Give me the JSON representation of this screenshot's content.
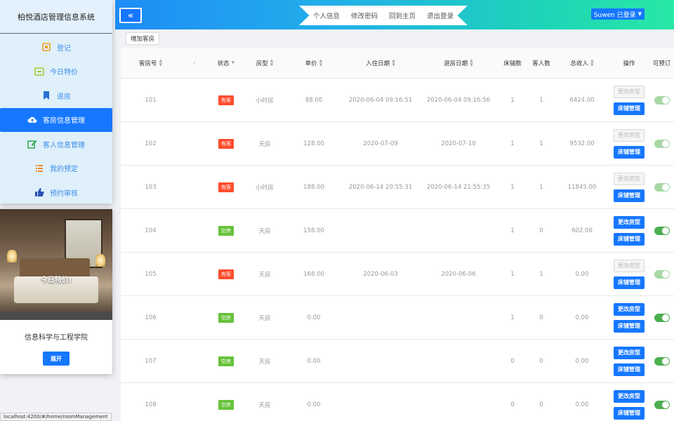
{
  "sidebar": {
    "title": "柏悦酒店管理信息系统",
    "items": [
      {
        "label": "登记",
        "icon": "register-icon",
        "active": false
      },
      {
        "label": "今日特价",
        "icon": "special-offer-icon",
        "active": false
      },
      {
        "label": "退房",
        "icon": "checkout-icon",
        "active": false
      },
      {
        "label": "客房信息管理",
        "icon": "cloud-upload-icon",
        "active": true
      },
      {
        "label": "客人信息管理",
        "icon": "edit-icon",
        "active": false
      },
      {
        "label": "我的预定",
        "icon": "list-icon",
        "active": false
      },
      {
        "label": "预约审核",
        "icon": "thumbs-up-icon",
        "active": false
      }
    ]
  },
  "promo": {
    "caption": "今日特价!",
    "text": "信息科学与工程学院",
    "button": "展开"
  },
  "topbar": {
    "collapse": "«",
    "nav": [
      "个人信息",
      "修改密码",
      "回到主页",
      "退出登录"
    ],
    "user": "Suwen 已登录"
  },
  "toolbar": {
    "add_label": "增加客房"
  },
  "table": {
    "headers": [
      "客房号",
      "状态",
      "房型",
      "单价",
      "入住日期",
      "退房日期",
      "床铺数",
      "客人数",
      "总收入",
      "操作",
      "可预订"
    ],
    "op_labels": {
      "modify": "更改房型",
      "bed": "床铺管理"
    },
    "rows": [
      {
        "room": "101",
        "status": "有客",
        "type": "小时房",
        "price": "88.00",
        "checkin": "2020-06-04 09:16:51",
        "checkout": "2020-06-04 09:16:56",
        "beds": "1",
        "guests": "1",
        "income": "6424.00",
        "modify_enabled": false,
        "bookable_dim": true
      },
      {
        "room": "102",
        "status": "有客",
        "type": "天房",
        "price": "128.00",
        "checkin": "2020-07-09",
        "checkout": "2020-07-10",
        "beds": "1",
        "guests": "1",
        "income": "9532.00",
        "modify_enabled": false,
        "bookable_dim": true
      },
      {
        "room": "103",
        "status": "有客",
        "type": "小时房",
        "price": "188.00",
        "checkin": "2020-06-14 20:55:31",
        "checkout": "2020-06-14 21:55:35",
        "beds": "1",
        "guests": "1",
        "income": "11845.00",
        "modify_enabled": false,
        "bookable_dim": true
      },
      {
        "room": "104",
        "status": "空房",
        "type": "天房",
        "price": "158.00",
        "checkin": "",
        "checkout": "",
        "beds": "1",
        "guests": "0",
        "income": "602.00",
        "modify_enabled": true,
        "bookable_dim": false
      },
      {
        "room": "105",
        "status": "有客",
        "type": "天房",
        "price": "168.00",
        "checkin": "2020-06-03",
        "checkout": "2020-06-06",
        "beds": "1",
        "guests": "1",
        "income": "0.00",
        "modify_enabled": false,
        "bookable_dim": true
      },
      {
        "room": "106",
        "status": "空房",
        "type": "天房",
        "price": "0.00",
        "checkin": "",
        "checkout": "",
        "beds": "1",
        "guests": "0",
        "income": "0.00",
        "modify_enabled": true,
        "bookable_dim": false
      },
      {
        "room": "107",
        "status": "空房",
        "type": "天房",
        "price": "0.00",
        "checkin": "",
        "checkout": "",
        "beds": "0",
        "guests": "0",
        "income": "0.00",
        "modify_enabled": true,
        "bookable_dim": false
      },
      {
        "room": "108",
        "status": "空房",
        "type": "天房",
        "price": "0.00",
        "checkin": "",
        "checkout": "",
        "beds": "0",
        "guests": "0",
        "income": "0.00",
        "modify_enabled": true,
        "bookable_dim": false
      }
    ]
  },
  "status_url": "localhost:4200/#/home/roomManagement"
}
